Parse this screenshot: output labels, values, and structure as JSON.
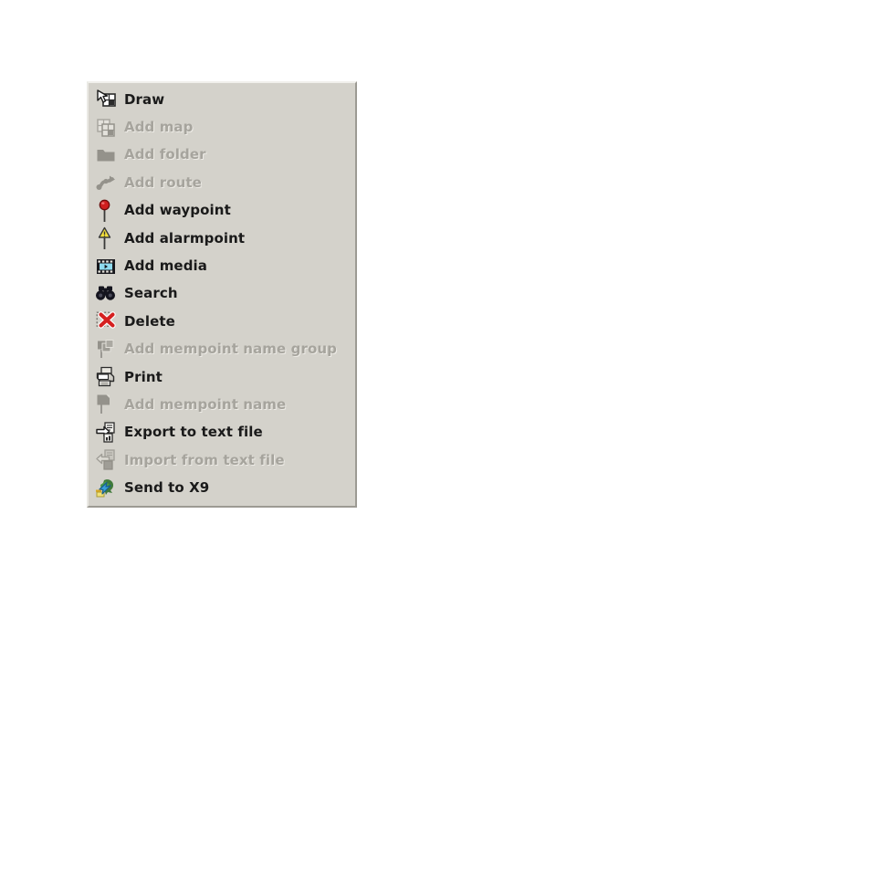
{
  "panel": {
    "name": "context-menu-toolbar",
    "background_color": "#d4d2cb",
    "border_light": "#f1f0ec",
    "border_dark": "#9c9a93",
    "enabled_text_color": "#1a1a1a",
    "disabled_text_color": "#a6a49d"
  },
  "menu": {
    "items": [
      {
        "label": "Draw",
        "icon": "draw-icon",
        "enabled": true
      },
      {
        "label": "Add map",
        "icon": "add-map-icon",
        "enabled": false
      },
      {
        "label": "Add folder",
        "icon": "add-folder-icon",
        "enabled": false
      },
      {
        "label": "Add route",
        "icon": "add-route-icon",
        "enabled": false
      },
      {
        "label": "Add waypoint",
        "icon": "add-waypoint-icon",
        "enabled": true
      },
      {
        "label": "Add alarmpoint",
        "icon": "add-alarmpoint-icon",
        "enabled": true
      },
      {
        "label": "Add media",
        "icon": "add-media-icon",
        "enabled": true
      },
      {
        "label": "Search",
        "icon": "search-binoculars-icon",
        "enabled": true
      },
      {
        "label": "Delete",
        "icon": "delete-icon",
        "enabled": true
      },
      {
        "label": "Add mempoint name group",
        "icon": "add-mempoint-name-group-icon",
        "enabled": false
      },
      {
        "label": "Print",
        "icon": "print-icon",
        "enabled": true
      },
      {
        "label": "Add mempoint name",
        "icon": "add-mempoint-name-icon",
        "enabled": false
      },
      {
        "label": "Export to text file",
        "icon": "export-to-text-file-icon",
        "enabled": true
      },
      {
        "label": "Import from text file",
        "icon": "import-from-text-file-icon",
        "enabled": false
      },
      {
        "label": "Send to X9",
        "icon": "send-to-x9-icon",
        "enabled": true
      }
    ]
  }
}
